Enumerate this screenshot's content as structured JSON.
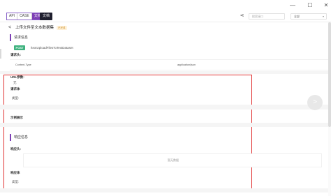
{
  "window": {
    "minimize_glyph": "—",
    "maximize_glyph": "☐",
    "close_glyph": "✕"
  },
  "toolbar": {
    "tabs": [
      {
        "label": "API",
        "active": false
      },
      {
        "label": "CASE",
        "active": false
      },
      {
        "label": "文档",
        "active": true
      }
    ],
    "doc_tab_label": "文档",
    "search_placeholder": "搜索接口",
    "env_select_value": "全部"
  },
  "page": {
    "title": "上传文件至文本数据集",
    "badge": "已完成"
  },
  "request": {
    "section_title": "请求信息",
    "method": "POST",
    "endpoint": "/textUploadFilesToTextDataset",
    "headers_label": "请求头:",
    "headers": [
      {
        "key": "Content-Type",
        "value": "application/json"
      }
    ],
    "url_params_label": "URL参数:",
    "url_params_value": "无",
    "body_label": "请求体",
    "body_type_label": "类型:",
    "example_label": "示例展示"
  },
  "response": {
    "section_title": "响应信息",
    "headers_label": "响应头:",
    "headers_empty_text": "暂无数据",
    "body_label": "响应体",
    "body_type_label": "类型:"
  },
  "colors": {
    "accent": "#7d3fb5",
    "method_post": "#3fb27f",
    "highlight_box": "#e03131",
    "badge_bg": "#fff3dc",
    "badge_text": "#c98a22"
  },
  "icons": {
    "back": "back-arrow-icon",
    "share": "share-icon",
    "next": "chevron-right-icon"
  }
}
